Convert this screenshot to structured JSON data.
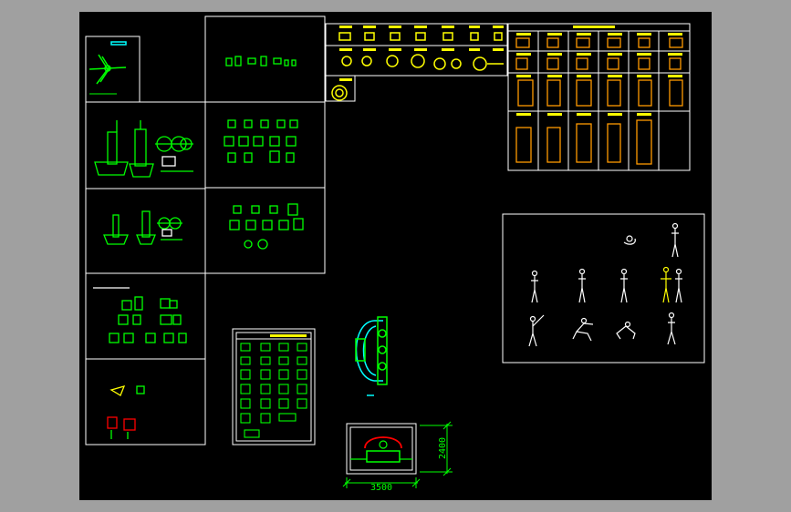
{
  "theme": {
    "frame": "#a0a0a0",
    "sheet": "#000000",
    "line": "#ffffff",
    "green": "#00ff00",
    "yellow": "#ffff00",
    "orange": "#ff9900",
    "red": "#ff0000",
    "cyan": "#00ffff"
  },
  "dimensions": {
    "width_label": "3500",
    "height_label": "2400"
  }
}
